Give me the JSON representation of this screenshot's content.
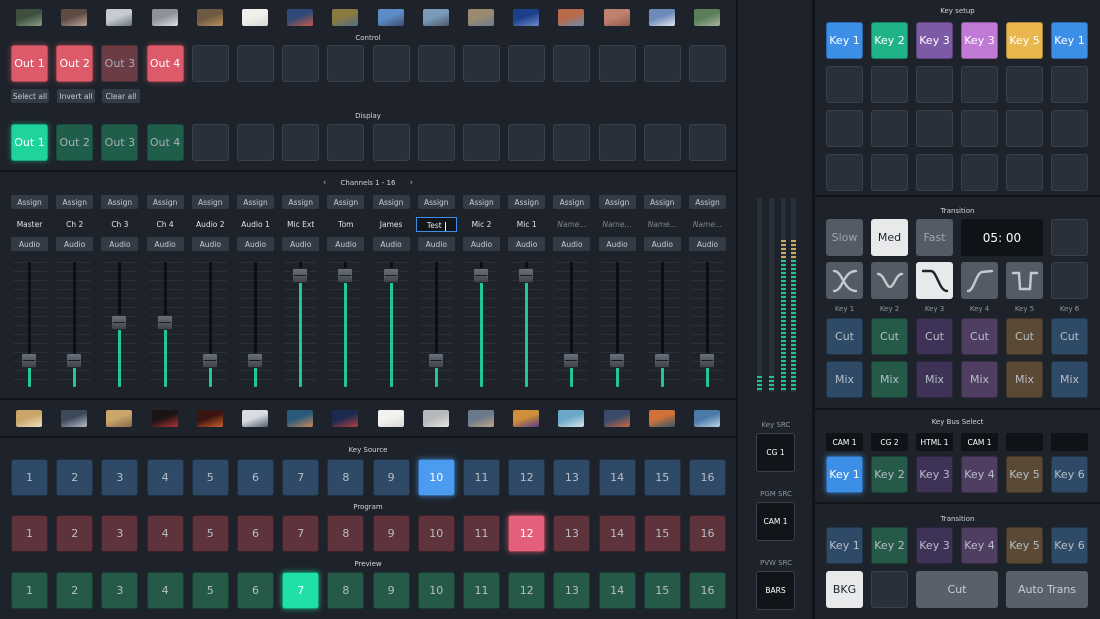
{
  "colors": {
    "out_red": "#dc5a6a",
    "out_red_dim": "#6b3c44",
    "disp_green": "#1fd39c",
    "disp_green_dim": "#1f5e4a",
    "key_blue": "#3d8ee6",
    "key_green": "#1fb387",
    "key_purple": "#7c5aa6",
    "key_pink": "#c07ad6",
    "key_yellow": "#e8b84f",
    "source_blue": "#2f4a66",
    "source_red": "#5e333b",
    "source_green": "#245a47"
  },
  "thumbs_top": [
    {
      "icon": "thumb-1-icon",
      "c1": "#3d5040",
      "c2": "#8c9f88"
    },
    {
      "icon": "thumb-2-icon",
      "c1": "#5f4a44",
      "c2": "#b6a79b"
    },
    {
      "icon": "thumb-3-icon",
      "c1": "#c8ccd2",
      "c2": "#6b7480"
    },
    {
      "icon": "thumb-4-icon",
      "c1": "#8e939a",
      "c2": "#dcdfe3"
    },
    {
      "icon": "thumb-5-icon",
      "c1": "#6e5a40",
      "c2": "#bb8f5e"
    },
    {
      "icon": "thumb-6-icon",
      "c1": "#efefec",
      "c2": "#d8d6d0"
    },
    {
      "icon": "thumb-7-icon",
      "c1": "#2f4a78",
      "c2": "#c75a47"
    },
    {
      "icon": "thumb-8-icon",
      "c1": "#8a7a40",
      "c2": "#4f6f8a"
    },
    {
      "icon": "thumb-9-icon",
      "c1": "#5c8cc8",
      "c2": "#3b4f6c"
    },
    {
      "icon": "thumb-10-icon",
      "c1": "#7a9ab8",
      "c2": "#4e5b6c"
    },
    {
      "icon": "thumb-11-icon",
      "c1": "#9a8a70",
      "c2": "#6e7d8c"
    },
    {
      "icon": "thumb-12-icon",
      "c1": "#1c3f8a",
      "c2": "#6d8cc8"
    },
    {
      "icon": "thumb-13-icon",
      "c1": "#b86a4a",
      "c2": "#6c8cb0"
    },
    {
      "icon": "thumb-14-icon",
      "c1": "#c08070",
      "c2": "#8c5b48"
    },
    {
      "icon": "thumb-15-icon",
      "c1": "#6e8ab8",
      "c2": "#dfe5ee"
    },
    {
      "icon": "thumb-16-icon",
      "c1": "#5a7d5a",
      "c2": "#a7b49b"
    }
  ],
  "control": {
    "title": "Control",
    "outs": [
      {
        "label": "Out 1",
        "state": "on"
      },
      {
        "label": "Out 2",
        "state": "on"
      },
      {
        "label": "Out 3",
        "state": "dim"
      },
      {
        "label": "Out 4",
        "state": "on"
      }
    ],
    "select_all": "Select all",
    "invert_all": "Invert all",
    "clear_all": "Clear all"
  },
  "display": {
    "title": "Display",
    "outs": [
      {
        "label": "Out 1",
        "state": "on"
      },
      {
        "label": "Out 2",
        "state": "dim"
      },
      {
        "label": "Out 3",
        "state": "dim"
      },
      {
        "label": "Out 4",
        "state": "dim"
      }
    ]
  },
  "channels": {
    "title": "Channels 1 - 16",
    "prev": "‹",
    "next": "›",
    "assign_label": "Assign",
    "audio_label": "Audio",
    "names": [
      "Master",
      "Ch 2",
      "Ch 3",
      "Ch 4",
      "Audio 2",
      "Audio 1",
      "Mic Ext",
      "Tom",
      "James",
      "Test",
      "Mic 2",
      "Mic 1",
      "Name...",
      "Name...",
      "Name...",
      "Name..."
    ],
    "placeholder": [
      false,
      false,
      false,
      false,
      false,
      false,
      false,
      false,
      false,
      false,
      false,
      false,
      true,
      true,
      true,
      true
    ],
    "editing_index": 9,
    "levels": [
      0.22,
      0.22,
      0.52,
      0.52,
      0.22,
      0.22,
      0.9,
      0.9,
      0.9,
      0.22,
      0.9,
      0.9,
      0.22,
      0.22,
      0.22,
      0.22
    ]
  },
  "thumbs_mid": [
    {
      "icon": "thumb-a-icon",
      "c1": "#c9a56a",
      "c2": "#efe0c0"
    },
    {
      "icon": "thumb-b-icon",
      "c1": "#3d4a5c",
      "c2": "#b8bcc4"
    },
    {
      "icon": "thumb-c-icon",
      "c1": "#caa66a",
      "c2": "#85694a"
    },
    {
      "icon": "thumb-d-icon",
      "c1": "#1a1414",
      "c2": "#b03434"
    },
    {
      "icon": "thumb-e-icon",
      "c1": "#3a1410",
      "c2": "#d0602e"
    },
    {
      "icon": "thumb-f-icon",
      "c1": "#d9dde2",
      "c2": "#556070"
    },
    {
      "icon": "thumb-g-icon",
      "c1": "#2a5a7a",
      "c2": "#c88a5a"
    },
    {
      "icon": "thumb-h-icon",
      "c1": "#1c2a50",
      "c2": "#b04040"
    },
    {
      "icon": "thumb-i-icon",
      "c1": "#f2f2f0",
      "c2": "#d6d6d2"
    },
    {
      "icon": "thumb-j-icon",
      "c1": "#b6b8bb",
      "c2": "#e6e6e4"
    },
    {
      "icon": "thumb-k-icon",
      "c1": "#6a7a8a",
      "c2": "#c2a58a"
    },
    {
      "icon": "thumb-l-icon",
      "c1": "#d0903a",
      "c2": "#5a3a8a"
    },
    {
      "icon": "thumb-m-icon",
      "c1": "#6aa8c8",
      "c2": "#d8e6ee"
    },
    {
      "icon": "thumb-n-icon",
      "c1": "#3a4a6a",
      "c2": "#c86a40"
    },
    {
      "icon": "thumb-o-icon",
      "c1": "#d0703a",
      "c2": "#2a5a6a"
    },
    {
      "icon": "thumb-p-icon",
      "c1": "#4a7aa8",
      "c2": "#c0d4e4"
    }
  ],
  "key_source": {
    "title": "Key Source",
    "buttons": [
      "1",
      "2",
      "3",
      "4",
      "5",
      "6",
      "7",
      "8",
      "9",
      "10",
      "11",
      "12",
      "13",
      "14",
      "15",
      "16"
    ],
    "active": 9
  },
  "program": {
    "title": "Program",
    "buttons": [
      "1",
      "2",
      "3",
      "4",
      "5",
      "6",
      "7",
      "8",
      "9",
      "10",
      "11",
      "12",
      "13",
      "14",
      "15",
      "16"
    ],
    "active": 11
  },
  "preview": {
    "title": "Preview",
    "buttons": [
      "1",
      "2",
      "3",
      "4",
      "5",
      "6",
      "7",
      "8",
      "9",
      "10",
      "11",
      "12",
      "13",
      "14",
      "15",
      "16"
    ],
    "active": 6
  },
  "meters": {
    "levels": [
      0.1,
      0.1,
      0.8,
      0.8
    ]
  },
  "sources": [
    {
      "label": "Key SRC",
      "value": "CG 1"
    },
    {
      "label": "PGM SRC",
      "value": "CAM 1"
    },
    {
      "label": "PVW SRC",
      "value": "BARS"
    }
  ],
  "key_setup": {
    "title": "Key setup",
    "keys": [
      {
        "label": "Key 1",
        "color": "#3d8ee6"
      },
      {
        "label": "Key 2",
        "color": "#1fb387"
      },
      {
        "label": "Key 3",
        "color": "#7c5aa6"
      },
      {
        "label": "Key 3",
        "color": "#c07ad6"
      },
      {
        "label": "Key 5",
        "color": "#e8b84f"
      },
      {
        "label": "Key 1",
        "color": "#3d8ee6"
      }
    ]
  },
  "transition1": {
    "title": "Transition",
    "speeds": [
      {
        "label": "Slow",
        "active": false
      },
      {
        "label": "Med",
        "active": true
      },
      {
        "label": "Fast",
        "active": false
      }
    ],
    "time": "05: 00",
    "curves": [
      {
        "icon": "curve-s-icon",
        "active": false
      },
      {
        "icon": "curve-dip-icon",
        "active": false
      },
      {
        "icon": "curve-ease-down-icon",
        "active": true
      },
      {
        "icon": "curve-ease-up-icon",
        "active": false
      },
      {
        "icon": "curve-notch-icon",
        "active": false
      }
    ],
    "key_labels": [
      "Key 1",
      "Key 2",
      "Key 3",
      "Key 4",
      "Key 5",
      "Key 6"
    ],
    "cut_label": "Cut",
    "mix_label": "Mix",
    "key_colors": [
      "#2f4a66",
      "#245a47",
      "#3e3356",
      "#4f3d62",
      "#5a4a35",
      "#2f4a66"
    ]
  },
  "key_bus": {
    "title": "Key Bus Select",
    "tags": [
      "CAM 1",
      "CG 2",
      "HTML 1",
      "CAM 1",
      "",
      ""
    ],
    "keys": [
      {
        "label": "Key 1",
        "color": "#3d8ee6",
        "active": true
      },
      {
        "label": "Key 2",
        "color": "#245a47",
        "active": false
      },
      {
        "label": "Key 3",
        "color": "#3e3356",
        "active": false
      },
      {
        "label": "Key 4",
        "color": "#4f3d62",
        "active": false
      },
      {
        "label": "Key 5",
        "color": "#5a4a35",
        "active": false
      },
      {
        "label": "Key 6",
        "color": "#2f4a66",
        "active": false
      }
    ]
  },
  "transition2": {
    "title": "Transition",
    "keys": [
      {
        "label": "Key 1",
        "color": "#2f4a66"
      },
      {
        "label": "Key 2",
        "color": "#245a47"
      },
      {
        "label": "Key 3",
        "color": "#3e3356"
      },
      {
        "label": "Key 4",
        "color": "#4f3d62"
      },
      {
        "label": "Key 5",
        "color": "#5a4a35"
      },
      {
        "label": "Key 6",
        "color": "#2f4a66"
      }
    ],
    "bkg": "BKG",
    "cut": "Cut",
    "auto": "Auto Trans"
  }
}
